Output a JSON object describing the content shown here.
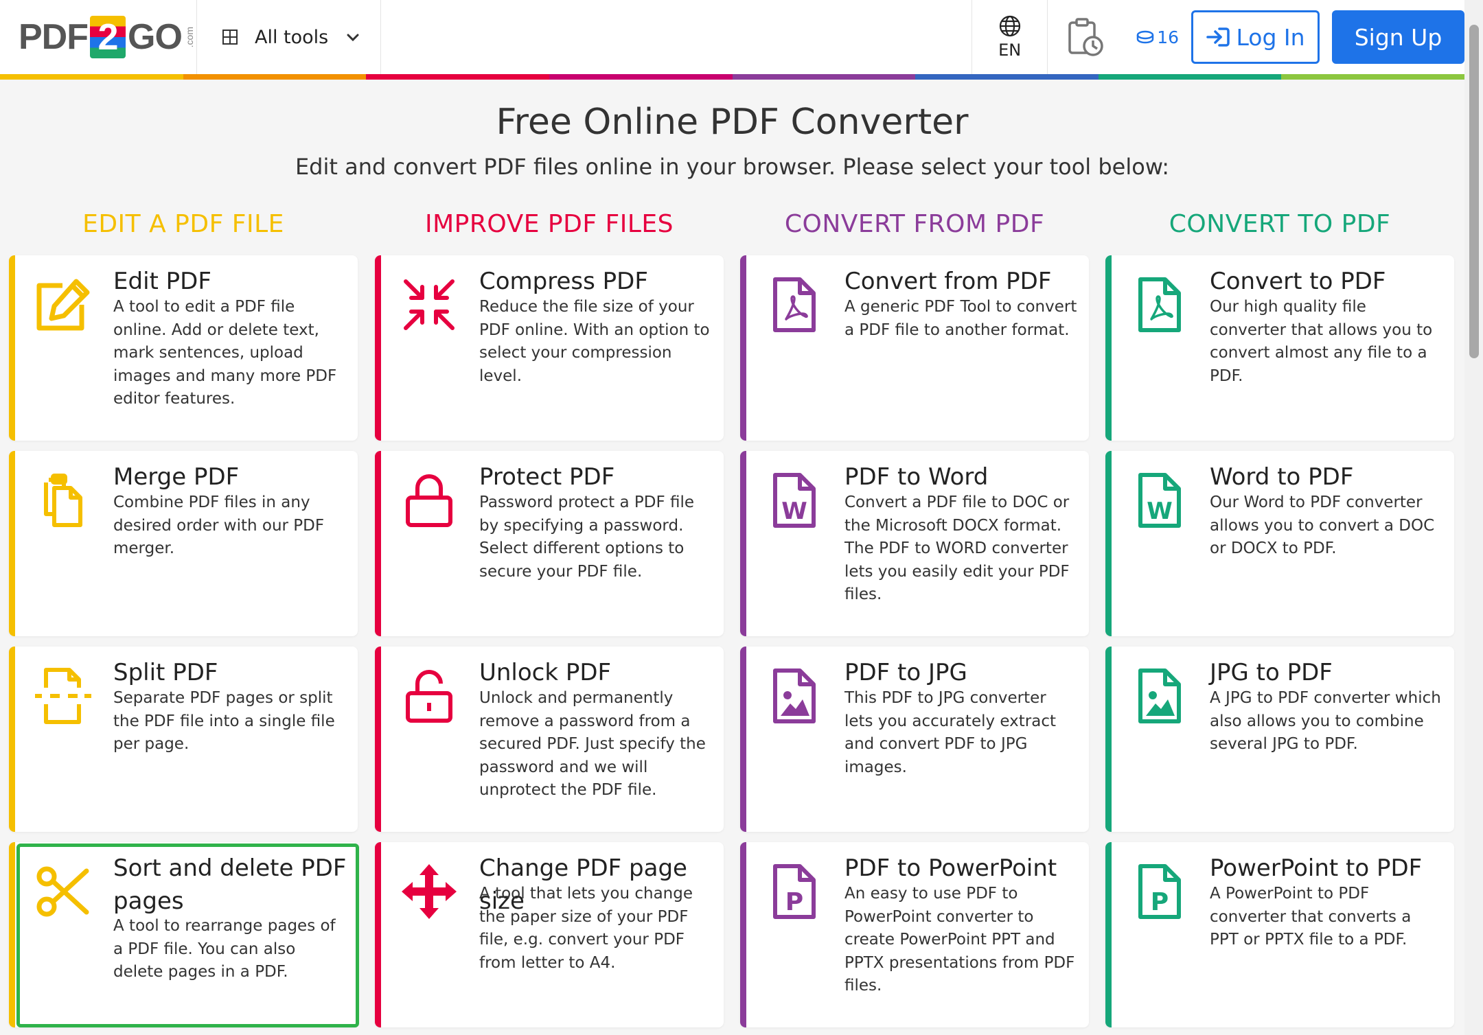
{
  "header": {
    "logo_left": "PDF",
    "logo_mid": "2",
    "logo_right": "GO",
    "logo_com": ".com",
    "all_tools": "All tools",
    "lang": "EN",
    "credits": "16",
    "login": "Log In",
    "signup": "Sign Up"
  },
  "colors": {
    "edit": "#f5bf00",
    "improve": "#e6003f",
    "convert_from": "#8b3c9a",
    "convert_to": "#16a77a",
    "brand_blue": "#1e73e8"
  },
  "main": {
    "title": "Free Online PDF Converter",
    "subtitle": "Edit and convert PDF files online in your browser. Please select your tool below:"
  },
  "columns": [
    {
      "heading": "EDIT A PDF FILE",
      "tools": [
        {
          "name": "Edit PDF",
          "desc": "A tool to edit a PDF file online. Add or delete text, mark sentences, upload images and many more PDF editor features.",
          "icon": "edit-icon"
        },
        {
          "name": "Merge PDF",
          "desc": "Combine PDF files in any desired order with our PDF merger.",
          "icon": "merge-icon"
        },
        {
          "name": "Split PDF",
          "desc": "Separate PDF pages or split the PDF file into a single file per page.",
          "icon": "split-icon"
        },
        {
          "name": "Sort and delete PDF pages",
          "desc": "A tool to rearrange pages of a PDF file. You can also delete pages in a PDF.",
          "icon": "scissors-icon"
        }
      ]
    },
    {
      "heading": "IMPROVE PDF FILES",
      "tools": [
        {
          "name": "Compress PDF",
          "desc": "Reduce the file size of your PDF online. With an option to select your compression level.",
          "icon": "compress-icon"
        },
        {
          "name": "Protect PDF",
          "desc": "Password protect a PDF file by specifying a password. Select different options to secure your PDF file.",
          "icon": "lock-icon"
        },
        {
          "name": "Unlock PDF",
          "desc": "Unlock and permanently remove a password from a secured PDF. Just specify the password and we will unprotect the PDF file.",
          "icon": "unlock-icon"
        },
        {
          "name": "Change PDF page size",
          "desc": "A tool that lets you change the paper size of your PDF file, e.g. convert your PDF from letter to A4.",
          "icon": "resize-arrows-icon"
        }
      ]
    },
    {
      "heading": "CONVERT FROM PDF",
      "tools": [
        {
          "name": "Convert from PDF",
          "desc": "A generic PDF Tool to convert a PDF file to another format.",
          "icon": "pdf-file-icon"
        },
        {
          "name": "PDF to Word",
          "desc": "Convert a PDF file to DOC or the Microsoft DOCX format. The PDF to WORD converter lets you easily edit your PDF files.",
          "icon": "word-file-icon"
        },
        {
          "name": "PDF to JPG",
          "desc": "This PDF to JPG converter lets you accurately extract and convert PDF to JPG images.",
          "icon": "image-file-icon"
        },
        {
          "name": "PDF to PowerPoint",
          "desc": "An easy to use PDF to PowerPoint converter to create PowerPoint PPT and PPTX presentations from PDF files.",
          "icon": "powerpoint-file-icon"
        }
      ]
    },
    {
      "heading": "CONVERT TO PDF",
      "tools": [
        {
          "name": "Convert to PDF",
          "desc": "Our high quality file converter that allows you to convert almost any file to a PDF.",
          "icon": "pdf-file-icon"
        },
        {
          "name": "Word to PDF",
          "desc": "Our Word to PDF converter allows you to convert a DOC or DOCX to PDF.",
          "icon": "word-file-icon"
        },
        {
          "name": "JPG to PDF",
          "desc": "A JPG to PDF converter which also allows you to combine several JPG to PDF.",
          "icon": "image-file-icon"
        },
        {
          "name": "PowerPoint to PDF",
          "desc": "A PowerPoint to PDF converter that converts a PPT or PPTX file to a PDF.",
          "icon": "powerpoint-file-icon"
        }
      ]
    }
  ]
}
